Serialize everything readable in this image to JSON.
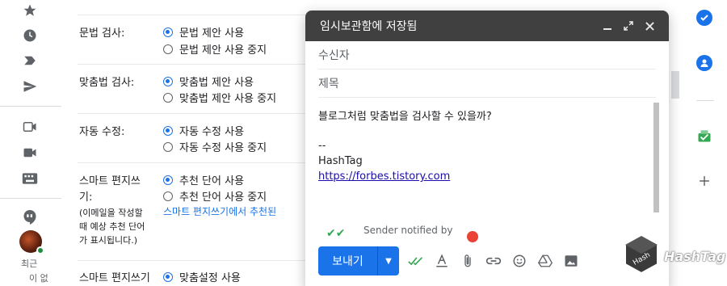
{
  "settings": {
    "grammar": {
      "label": "문법 검사:",
      "opt_on": "문법 제안 사용",
      "opt_off": "문법 제안 사용 중지"
    },
    "spelling": {
      "label": "맞춤법 검사:",
      "opt_on": "맞춤법 제안 사용",
      "opt_off": "맞춤법 제안 사용 중지"
    },
    "autocorrect": {
      "label": "자동 수정:",
      "opt_on": "자동 수정 사용",
      "opt_off": "자동 수정 사용 중지"
    },
    "smart_compose": {
      "label_line1": "스마트 편지쓰",
      "label_line2": "기:",
      "sub_line1": "(이메일을 작성할",
      "sub_line2": "때 예상 추천 단어",
      "sub_line3": "가 표시됩니다.)",
      "opt_on": "추천 단어 사용",
      "opt_off": "추천 단어 사용 중지",
      "link": "스마트 편지쓰기에서 추천된"
    },
    "smart_compose_personal": {
      "label": "스마트 편지쓰기",
      "opt_on": "맞춤설정 사용"
    }
  },
  "left_rail": {
    "tail_line1": "최근",
    "tail_line2": "이 없"
  },
  "compose": {
    "title": "임시보관함에 저장됨",
    "to_placeholder": "수신자",
    "subject_placeholder": "제목",
    "body_line1": "블로그처럼 맞춤법을 검사할 수 있을까?",
    "body_sig_dash": "--",
    "body_sig_name": "HashTag",
    "body_sig_link": "https://forbes.tistory.com",
    "notice": "Sender notified by",
    "send_label": "보내기"
  },
  "watermark": {
    "text": "HashTag"
  },
  "colors": {
    "accent": "#1a73e8",
    "header": "#404040"
  }
}
